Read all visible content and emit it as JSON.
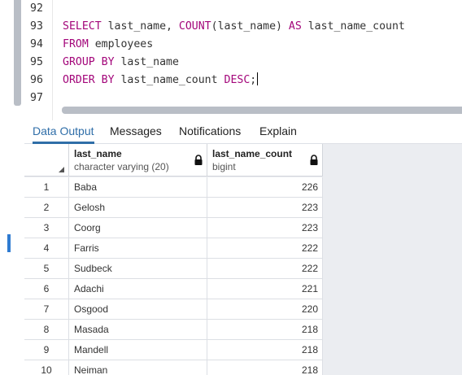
{
  "editor": {
    "lines": [
      {
        "no": "92",
        "tokens": []
      },
      {
        "no": "93",
        "tokens": [
          {
            "t": "SELECT",
            "kw": true
          },
          {
            "t": " last_name, ",
            "kw": false
          },
          {
            "t": "COUNT",
            "kw": true
          },
          {
            "t": "(last_name) ",
            "kw": false
          },
          {
            "t": "AS",
            "kw": true
          },
          {
            "t": " last_name_count",
            "kw": false
          }
        ]
      },
      {
        "no": "94",
        "tokens": [
          {
            "t": "FROM",
            "kw": true
          },
          {
            "t": " employees",
            "kw": false
          }
        ]
      },
      {
        "no": "95",
        "tokens": [
          {
            "t": "GROUP BY",
            "kw": true
          },
          {
            "t": " last_name",
            "kw": false
          }
        ]
      },
      {
        "no": "96",
        "tokens": [
          {
            "t": "ORDER BY",
            "kw": true
          },
          {
            "t": " last_name_count ",
            "kw": false
          },
          {
            "t": "DESC",
            "kw": true
          },
          {
            "t": ";",
            "kw": false
          }
        ],
        "cursor": true
      },
      {
        "no": "97",
        "tokens": []
      }
    ]
  },
  "tabs": [
    {
      "label": "Data Output",
      "active": true
    },
    {
      "label": "Messages",
      "active": false
    },
    {
      "label": "Notifications",
      "active": false
    },
    {
      "label": "Explain",
      "active": false
    }
  ],
  "grid": {
    "columns": [
      {
        "name": "last_name",
        "type": "character varying (20)"
      },
      {
        "name": "last_name_count",
        "type": "bigint"
      }
    ],
    "rows": [
      {
        "n": "1",
        "name": "Baba",
        "count": "226"
      },
      {
        "n": "2",
        "name": "Gelosh",
        "count": "223"
      },
      {
        "n": "3",
        "name": "Coorg",
        "count": "223"
      },
      {
        "n": "4",
        "name": "Farris",
        "count": "222"
      },
      {
        "n": "5",
        "name": "Sudbeck",
        "count": "222"
      },
      {
        "n": "6",
        "name": "Adachi",
        "count": "221"
      },
      {
        "n": "7",
        "name": "Osgood",
        "count": "220"
      },
      {
        "n": "8",
        "name": "Masada",
        "count": "218"
      },
      {
        "n": "9",
        "name": "Mandell",
        "count": "218"
      },
      {
        "n": "10",
        "name": "Neiman",
        "count": "218"
      }
    ]
  },
  "colors": {
    "keyword": "#a3067a",
    "active_tab": "#2f6ea8",
    "grid_bg": "#ebedf1"
  },
  "icons": {
    "column_lock": "lock-icon",
    "select_all": "corner-triangle-icon"
  }
}
